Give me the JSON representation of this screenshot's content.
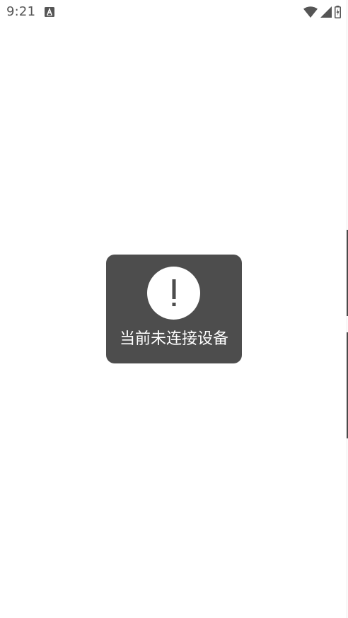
{
  "status_bar": {
    "time": "9:21",
    "notification_icon": "a-icon",
    "wifi_icon": "wifi-icon",
    "signal_icon": "cell-signal-icon",
    "battery_icon": "battery-charging-icon"
  },
  "toast": {
    "icon": "exclamation-icon",
    "message": "当前未连接设备"
  },
  "colors": {
    "toast_bg": "#4d4d4d",
    "toast_text": "#ffffff",
    "status_icon": "#555555"
  }
}
